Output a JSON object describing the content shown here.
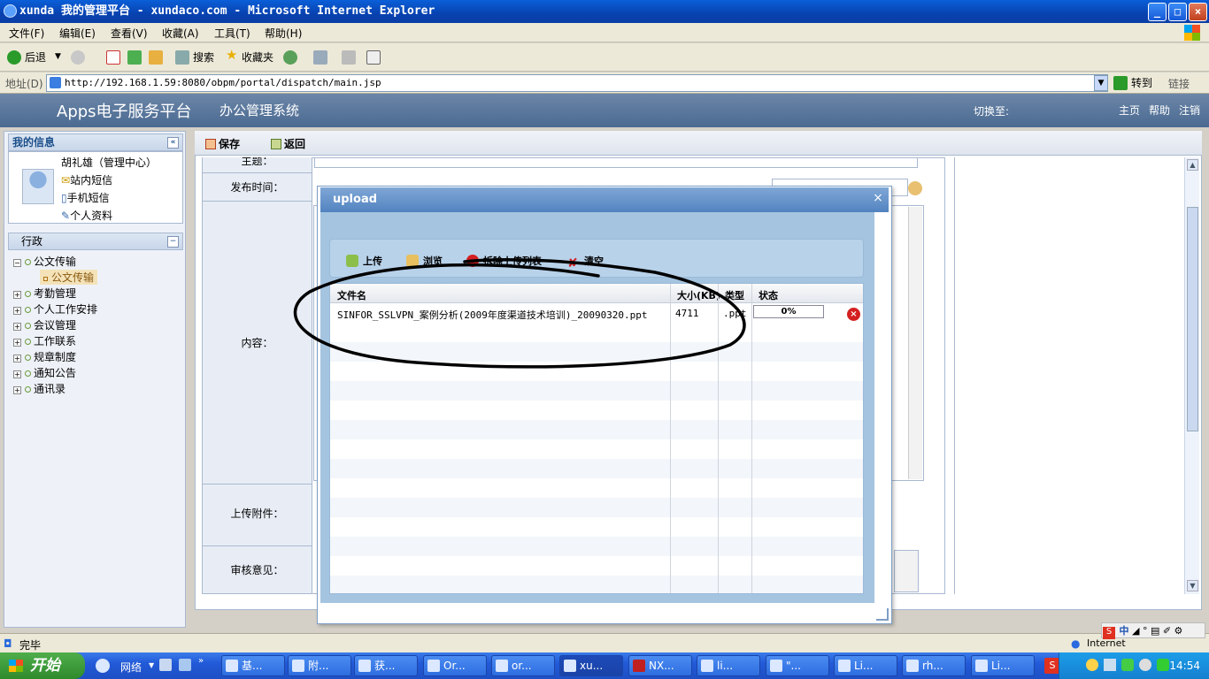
{
  "window": {
    "title": "xunda 我的管理平台 - xundaco.com - Microsoft Internet Explorer",
    "minimize": "_",
    "maximize": "□",
    "close": "×"
  },
  "menu": [
    "文件(F)",
    "编辑(E)",
    "查看(V)",
    "收藏(A)",
    "工具(T)",
    "帮助(H)"
  ],
  "toolbar": {
    "back": "后退",
    "search": "搜索",
    "favorites": "收藏夹"
  },
  "address": {
    "label": "地址(D)",
    "url": "http://192.168.1.59:8080/obpm/portal/dispatch/main.jsp",
    "go": "转到",
    "links": "链接"
  },
  "app": {
    "logo": "Apps电子服务平台",
    "system": "办公管理系统",
    "switch": "切换至:",
    "nav": [
      "主页",
      "帮助",
      "注销"
    ]
  },
  "sidebar": {
    "myinfo_title": "我的信息",
    "user": "胡礼雄（管理中心）",
    "links": [
      "站内短信",
      "手机短信",
      "个人资料"
    ],
    "section_title": "行政",
    "tree": [
      {
        "label": "公文传输",
        "expanded": true
      },
      {
        "label": "公文传输",
        "child": true,
        "selected": true
      },
      {
        "label": "考勤管理"
      },
      {
        "label": "个人工作安排"
      },
      {
        "label": "会议管理"
      },
      {
        "label": "工作联系"
      },
      {
        "label": "规章制度"
      },
      {
        "label": "通知公告"
      },
      {
        "label": "通讯录"
      }
    ]
  },
  "form": {
    "save": "保存",
    "back": "返回",
    "labels": {
      "subject": "主题：",
      "publish_time": "发布时间：",
      "content": "内容：",
      "attachment": "上传附件：",
      "review": "审核意见："
    }
  },
  "dialog": {
    "title": "upload",
    "close": "×",
    "tools": [
      "上传",
      "浏览",
      "拆除上传列表",
      "清空"
    ],
    "columns": [
      "文件名",
      "大小(KB)",
      "类型",
      "状态"
    ],
    "files": [
      {
        "name": "SINFOR_SSLVPN_案例分析(2009年度渠道技术培训)_20090320.ppt",
        "size": "4711",
        "type": ".ppt",
        "status": "0%"
      }
    ]
  },
  "status": {
    "text": "完毕",
    "zone": "Internet"
  },
  "taskbar": {
    "start": "开始",
    "network": "网络",
    "tasks": [
      "基...",
      "附...",
      "获...",
      "Or...",
      "or...",
      "xu...",
      "NX...",
      "li...",
      "\"...",
      "Li...",
      "rh...",
      "Li..."
    ],
    "clock": "14:54"
  },
  "ime": "中"
}
